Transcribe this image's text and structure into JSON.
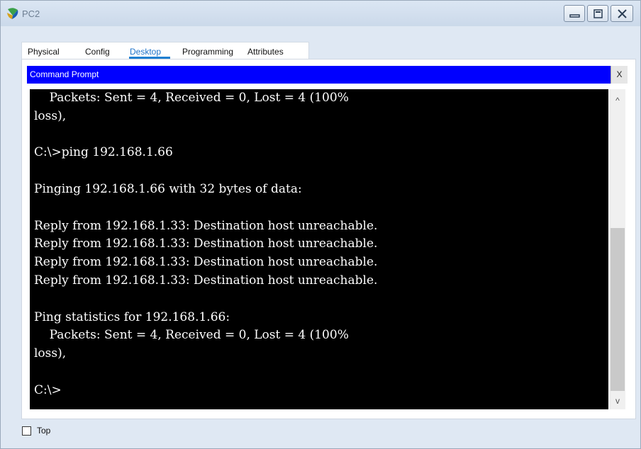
{
  "window": {
    "title": "PC2",
    "controls": [
      "minimize-icon",
      "maximize-icon",
      "close-icon"
    ]
  },
  "tabs": [
    {
      "label": "Physical",
      "active": false
    },
    {
      "label": "Config",
      "active": false
    },
    {
      "label": "Desktop",
      "active": true
    },
    {
      "label": "Programming",
      "active": false
    },
    {
      "label": "Attributes",
      "active": false
    }
  ],
  "command_prompt": {
    "title": "Command Prompt",
    "close_label": "X",
    "lines": [
      "    Packets: Sent = 4, Received = 0, Lost = 4 (100%",
      "loss),",
      "",
      "C:\\>ping 192.168.1.66",
      "",
      "Pinging 192.168.1.66 with 32 bytes of data:",
      "",
      "Reply from 192.168.1.33: Destination host unreachable.",
      "Reply from 192.168.1.33: Destination host unreachable.",
      "Reply from 192.168.1.33: Destination host unreachable.",
      "Reply from 192.168.1.33: Destination host unreachable.",
      "",
      "Ping statistics for 192.168.1.66:",
      "    Packets: Sent = 4, Received = 0, Lost = 4 (100%",
      "loss),",
      "",
      "C:\\>"
    ]
  },
  "footer": {
    "top_checkbox_label": "Top",
    "top_checked": false
  },
  "colors": {
    "accent": "#1f7fd0",
    "prompt_header": "#0000ff",
    "console_bg": "#000000",
    "console_fg": "#ffffff"
  }
}
